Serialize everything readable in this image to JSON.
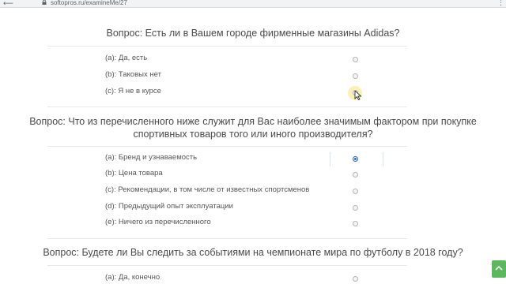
{
  "browser": {
    "url": "softopros.ru/examineMe/27"
  },
  "questions": [
    {
      "text": "Вопрос: Есть ли в Вашем городе фирменные магазины Adidas?",
      "options": [
        {
          "label": "(a): Да, есть",
          "checked": false
        },
        {
          "label": "(b): Таковых нет",
          "checked": false
        },
        {
          "label": "(c): Я не в курсе",
          "checked": false
        }
      ]
    },
    {
      "text": "Вопрос: Что из перечисленного ниже служит для Вас наиболее значимым фактором при покупке спортивных товаров того или иного производителя?",
      "options": [
        {
          "label": "(a): Бренд и узнаваемость",
          "checked": true
        },
        {
          "label": "(b): Цена товара",
          "checked": false
        },
        {
          "label": "(c): Рекомендации, в том числе от известных спортсменов",
          "checked": false
        },
        {
          "label": "(d): Предыдущий опыт эксплуатации",
          "checked": false
        },
        {
          "label": "(e): Ничего из перечисленного",
          "checked": false
        }
      ]
    },
    {
      "text": "Вопрос: Будете ли Вы следить за событиями на чемпионате мира по футболу в 2018 году?",
      "options": [
        {
          "label": "(a): Да, конечно",
          "checked": false
        }
      ]
    }
  ],
  "colors": {
    "accent": "#2b64c8",
    "scroll_button": "#5cb85c"
  }
}
